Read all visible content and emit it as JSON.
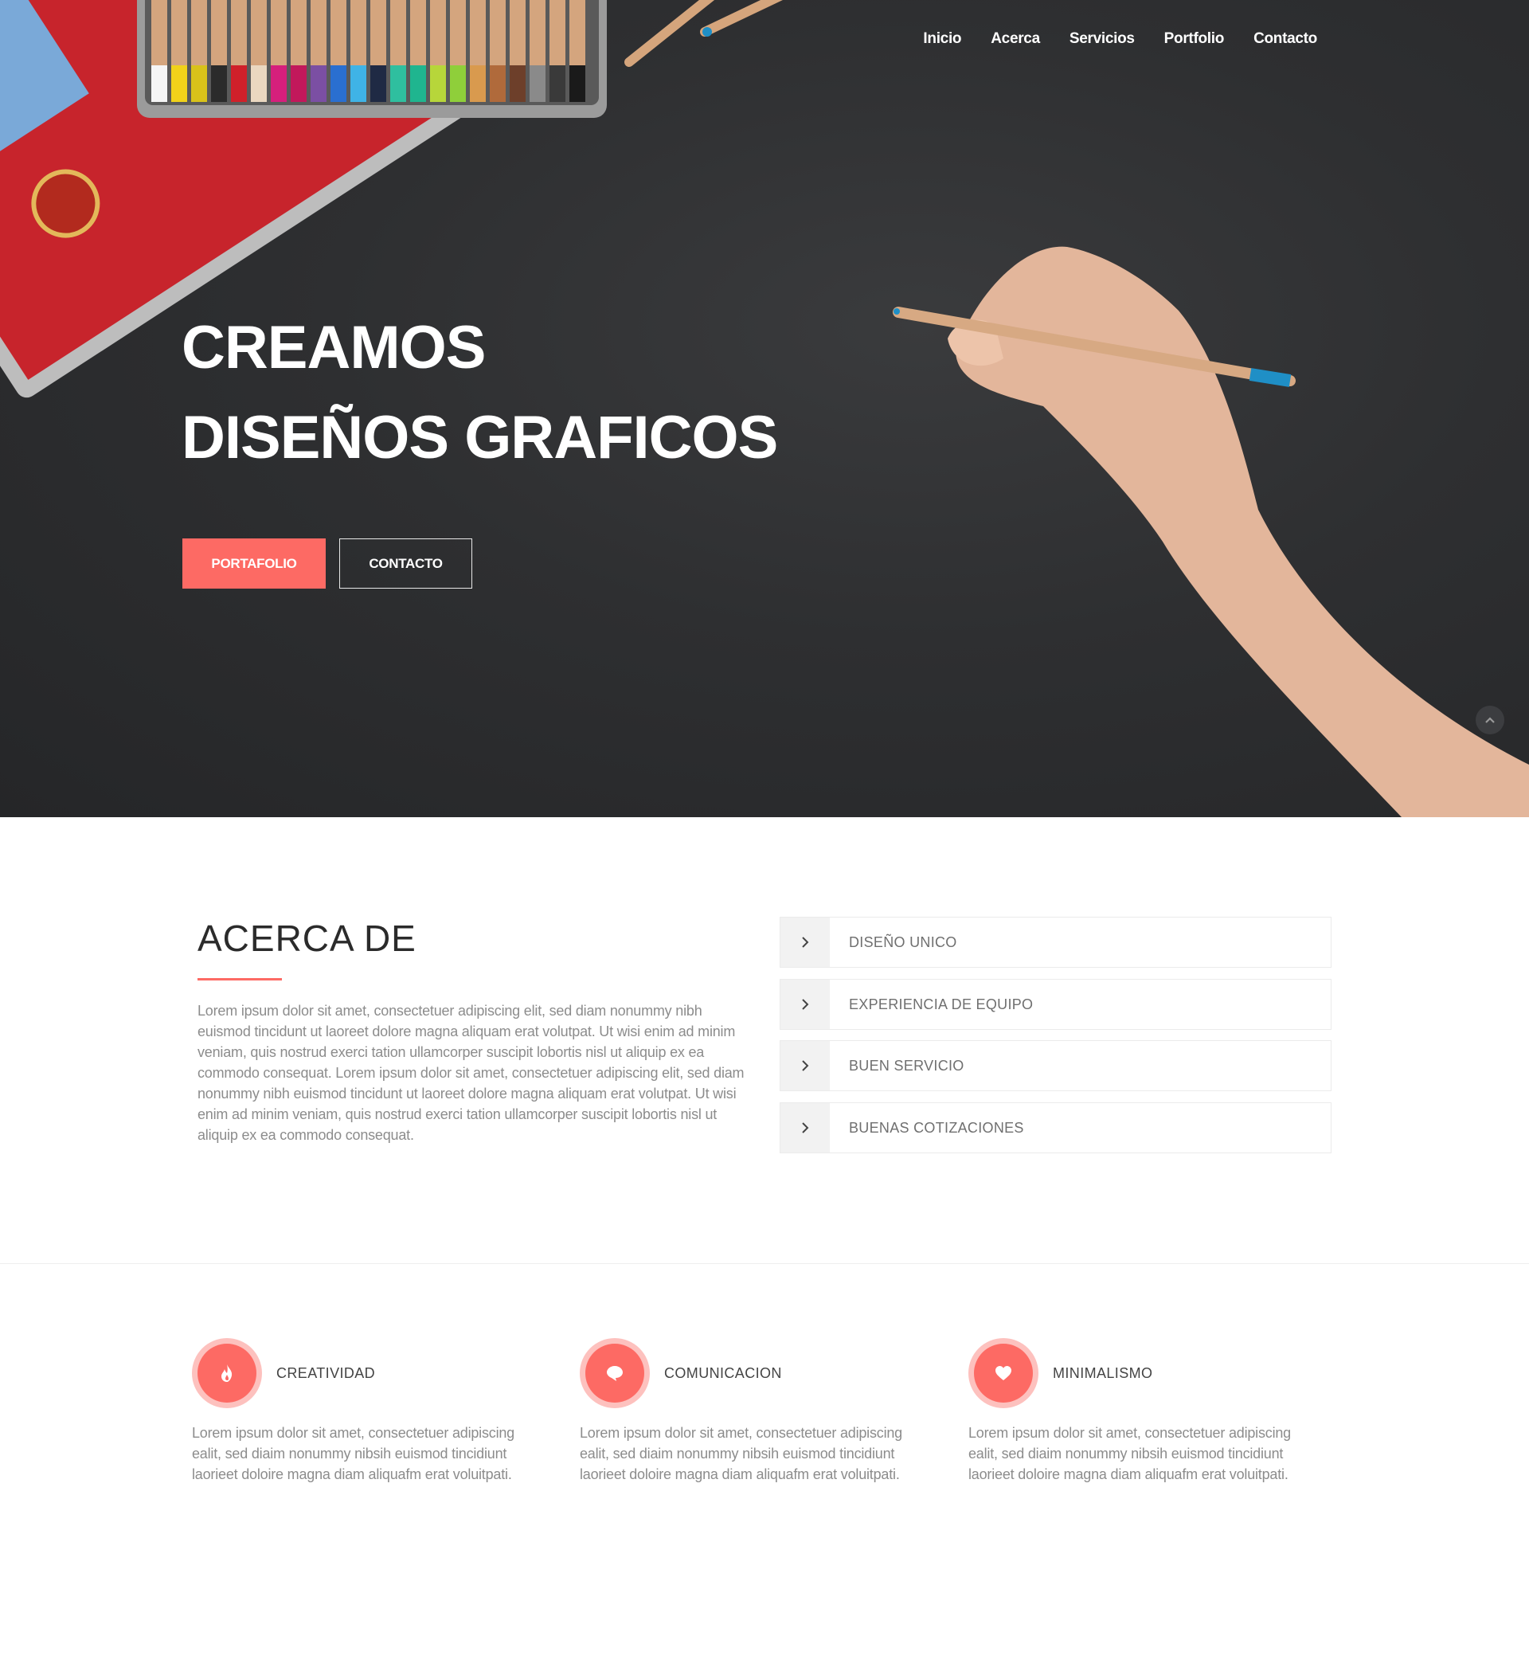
{
  "nav": {
    "items": [
      "Inicio",
      "Acerca",
      "Servicios",
      "Portfolio",
      "Contacto"
    ]
  },
  "hero": {
    "title_line1": "CREAMOS",
    "title_line2": "DISEÑOS GRAFICOS",
    "primary_button": "PORTAFOLIO",
    "secondary_button": "CONTACTO",
    "accent_color": "#fd6a64",
    "scroll_icon": "chevron-up-icon"
  },
  "about": {
    "title": "ACERCA DE",
    "text": "Lorem ipsum dolor sit amet, consectetuer adipiscing elit, sed diam nonummy nibh euismod tincidunt ut laoreet dolore magna aliquam erat volutpat. Ut wisi enim ad minim veniam, quis nostrud exerci tation ullamcorper suscipit lobortis nisl ut aliquip ex ea commodo consequat. Lorem ipsum dolor sit amet, consectetuer adipiscing elit, sed diam nonummy nibh euismod tincidunt ut laoreet dolore magna aliquam erat volutpat. Ut wisi enim ad minim veniam, quis nostrud exerci tation ullamcorper suscipit lobortis nisl ut aliquip ex ea commodo consequat.",
    "accordion": [
      {
        "label": "DISEÑO UNICO"
      },
      {
        "label": "EXPERIENCIA DE EQUIPO"
      },
      {
        "label": "BUEN SERVICIO"
      },
      {
        "label": "BUENAS COTIZACIONES"
      }
    ]
  },
  "features": [
    {
      "title": "CREATIVIDAD",
      "icon": "fire-icon",
      "text": "Lorem ipsum dolor sit amet, consectetuer adipiscing ealit, sed diaim nonummy nibsih euismod tincidiunt laorieet doloire magna diam aliquafm erat voluitpati."
    },
    {
      "title": "COMUNICACION",
      "icon": "chat-bubble-icon",
      "text": "Lorem ipsum dolor sit amet, consectetuer adipiscing ealit, sed diaim nonummy nibsih euismod tincidiunt laorieet doloire magna diam aliquafm erat voluitpati."
    },
    {
      "title": "MINIMALISMO",
      "icon": "heart-icon",
      "text": "Lorem ipsum dolor sit amet, consectetuer adipiscing ealit, sed diaim nonummy nibsih euismod tincidiunt laorieet doloire magna diam aliquafm erat voluitpati."
    }
  ]
}
